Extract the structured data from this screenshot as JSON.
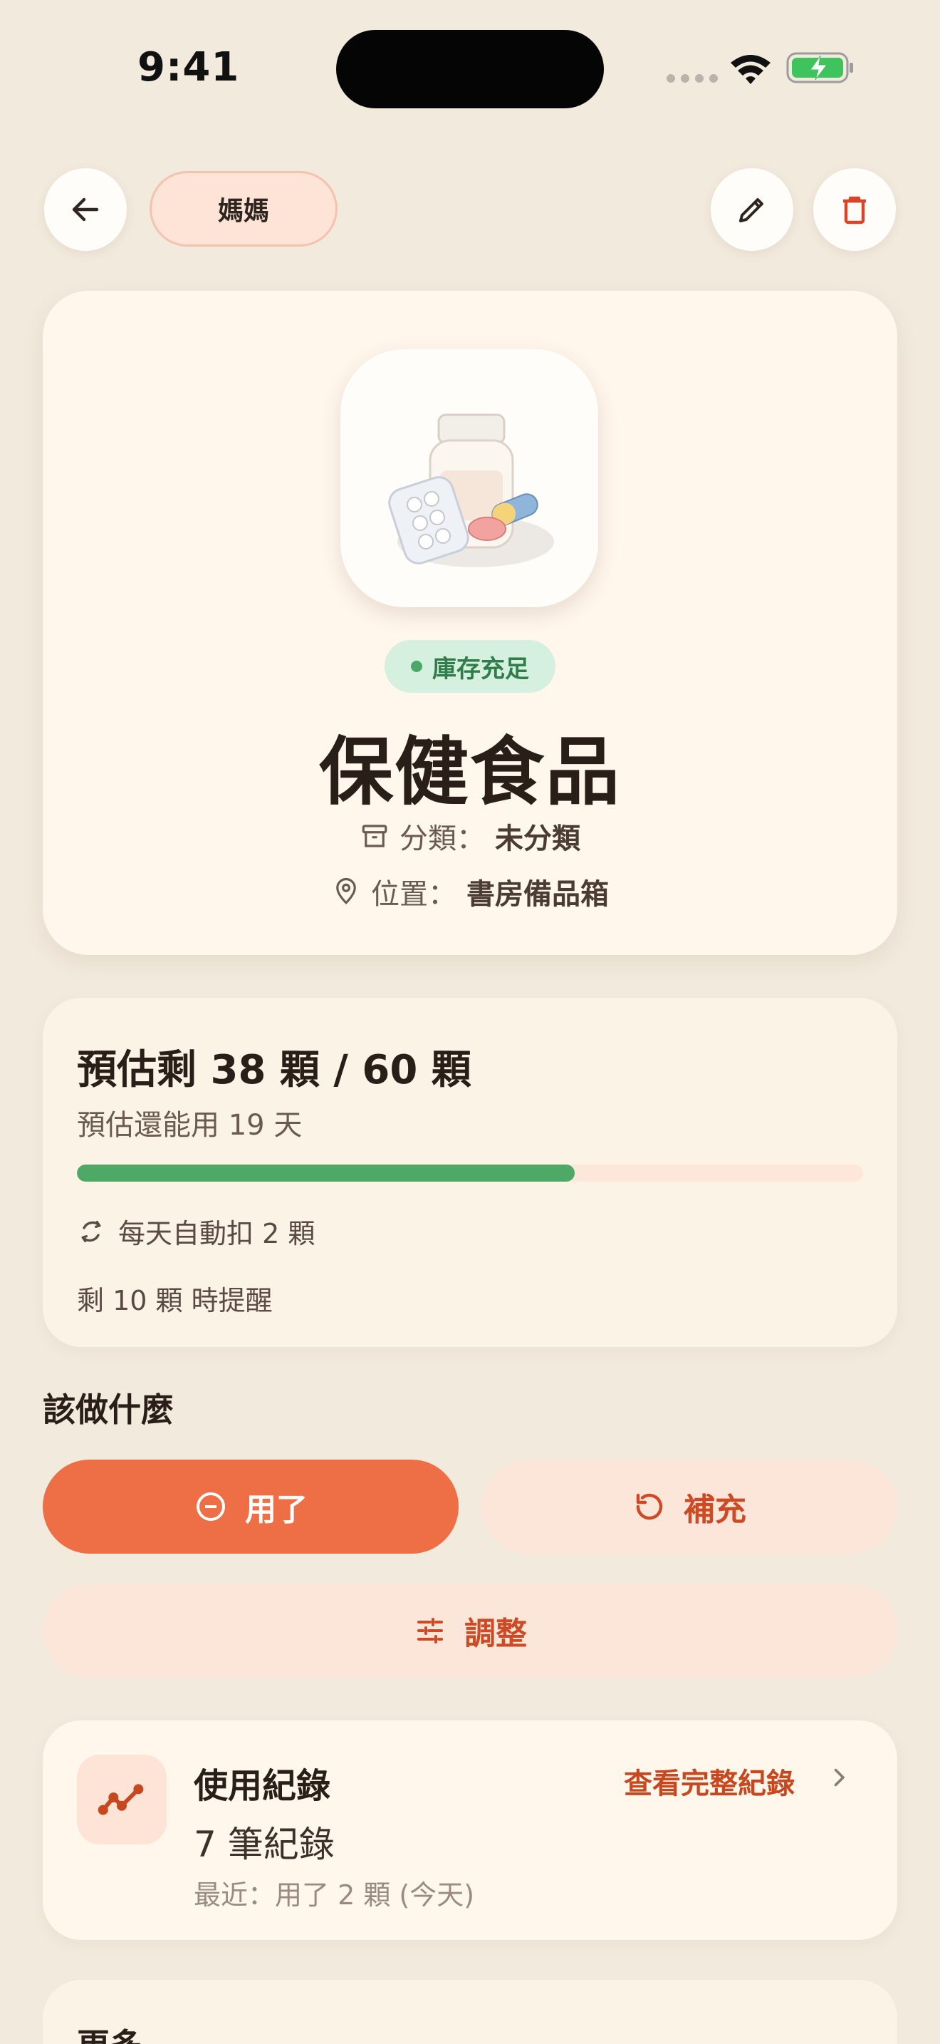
{
  "status_bar": {
    "time": "9:41"
  },
  "profile": {
    "name": "媽媽"
  },
  "item": {
    "stock_status": "庫存充足",
    "name": "保健食品",
    "category_label": "分類：",
    "category_value": "未分類",
    "location_label": "位置：",
    "location_value": "書房備品箱"
  },
  "stock": {
    "summary": "預估剩 38 顆 / 60 顆",
    "days_left": "預估還能用 19 天",
    "remaining": 38,
    "total": 60,
    "auto_deduct": "每天自動扣 2 顆",
    "reminder": "剩 10 顆 時提醒"
  },
  "actions": {
    "section_title": "該做什麼",
    "used_label": "用了",
    "refill_label": "補充",
    "adjust_label": "調整"
  },
  "history": {
    "title": "使用紀錄",
    "view_all": "查看完整紀錄",
    "count": "7 筆紀錄",
    "recent": "最近：用了 2 顆 (今天)"
  },
  "more": {
    "title": "更多"
  },
  "colors": {
    "accent": "#ee6e45",
    "accent_text": "#cc4a24",
    "success": "#4ea866",
    "background": "#f2eadd"
  }
}
